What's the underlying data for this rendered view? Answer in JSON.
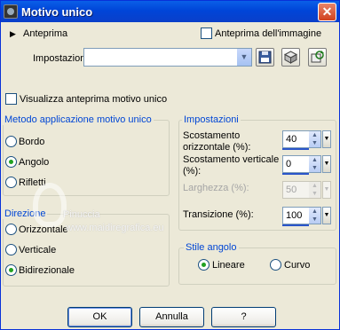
{
  "window": {
    "title": "Motivo unico",
    "close_glyph": "✕"
  },
  "preview": {
    "label": "Anteprima",
    "image_preview_label": "Anteprima dell'immagine",
    "image_preview_checked": false
  },
  "settings_row": {
    "label": "Impostazioni",
    "value": "",
    "icons": [
      "save-icon",
      "preset-cube-icon",
      "reset-preset-icon"
    ]
  },
  "show_preview": {
    "label": "Visualizza anteprima motivo unico",
    "checked": false
  },
  "method_group": {
    "title": "Metodo applicazione motivo unico",
    "options": [
      {
        "label": "Bordo",
        "selected": false
      },
      {
        "label": "Angolo",
        "selected": true
      },
      {
        "label": "Rifletti",
        "selected": false
      }
    ]
  },
  "direction_group": {
    "title": "Direzione",
    "options": [
      {
        "label": "Orizzontale",
        "selected": false
      },
      {
        "label": "Verticale",
        "selected": false
      },
      {
        "label": "Bidirezionale",
        "selected": true
      }
    ]
  },
  "settings_group": {
    "title": "Impostazioni",
    "horizontal_offset": {
      "label_line1": "Scostamento",
      "label_line2": "orizzontale (%):",
      "value": "40"
    },
    "vertical_offset": {
      "label_line1": "Scostamento verticale",
      "label_line2": "(%):",
      "value": "0"
    },
    "width": {
      "label": "Larghezza (%):",
      "value": "50",
      "enabled": false
    },
    "transition": {
      "label": "Transizione (%):",
      "value": "100"
    }
  },
  "corner_style_group": {
    "title": "Stile angolo",
    "options": [
      {
        "label": "Lineare",
        "selected": true
      },
      {
        "label": "Curvo",
        "selected": false
      }
    ]
  },
  "watermark": {
    "line1": "Pinuccia",
    "line2": "www.maidiregrafica.eu"
  },
  "buttons": {
    "ok": "OK",
    "cancel": "Annulla",
    "help": "?"
  },
  "colors": {
    "title_bar": "#0054e3",
    "group_title": "#0046d5",
    "radio_dot": "#21a121"
  }
}
